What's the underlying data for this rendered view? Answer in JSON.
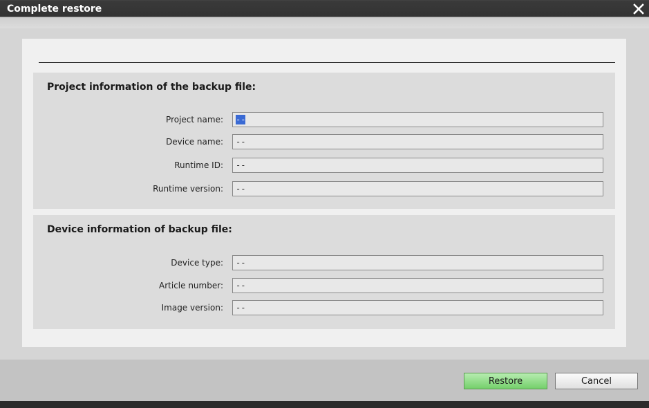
{
  "dialog": {
    "title": "Complete restore",
    "close_icon": "close-icon"
  },
  "project_group": {
    "title": "Project information of the backup file:",
    "fields": [
      {
        "label": "Project name:",
        "value": "--"
      },
      {
        "label": "Device name:",
        "value": "--"
      },
      {
        "label": "Runtime ID:",
        "value": "--"
      },
      {
        "label": "Runtime version:",
        "value": "--"
      }
    ]
  },
  "device_group": {
    "title": "Device information of backup file:",
    "fields": [
      {
        "label": "Device type:",
        "value": "--"
      },
      {
        "label": "Article number:",
        "value": "--"
      },
      {
        "label": "Image version:",
        "value": "--"
      }
    ]
  },
  "buttons": {
    "restore": "Restore",
    "cancel": "Cancel"
  },
  "colors": {
    "title_bar": "#333333",
    "restore_button": "#8ddc84",
    "selection": "#3a6ad4"
  }
}
